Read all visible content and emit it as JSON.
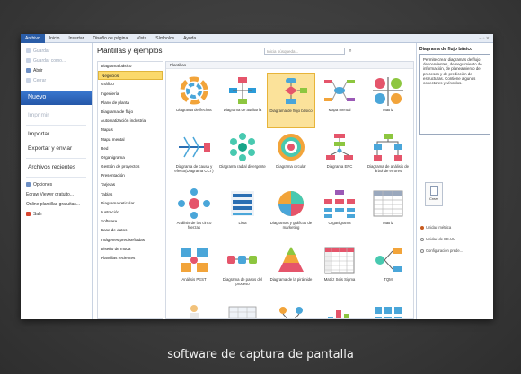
{
  "ribbon": {
    "tabs": [
      "Archivo",
      "Inicio",
      "Insertar",
      "Diseño de página",
      "Vista",
      "Símbolos",
      "Ayuda"
    ],
    "active_tab": "Archivo",
    "window_controls": "– ▫ ✕"
  },
  "backstage": {
    "top_items": [
      "Guardar",
      "Guardar como...",
      "Abrir",
      "Cerrar"
    ],
    "nuevo": "Nuevo",
    "imprimir": "Imprimir",
    "importar": "Importar",
    "exportar": "Exportar y enviar",
    "recientes": "Archivos recientes",
    "bottom_items": [
      "Opciones",
      "Edraw Viewer gratuito...",
      "Online plantillas gratuitas...",
      "Salir"
    ]
  },
  "main": {
    "title": "Plantillas y ejemplos",
    "search_placeholder": "Inicia búsqueda...",
    "grid_header": "Plantillas",
    "categories": [
      "Diagrama básico",
      "Negocios",
      "Gráfico",
      "Ingeniería",
      "Plano de planta",
      "Diagrama de flujo",
      "Automatización industrial",
      "Mapas",
      "Mapa mental",
      "Red",
      "Organigrama",
      "Gestión de proyectos",
      "Presentación",
      "Tarjetas",
      "Tablas",
      "Diagrama reticular",
      "Ilustración",
      "Software",
      "Base de datos",
      "Imágenes prediseñadas",
      "Diseño de moda",
      "Plantillas recientes"
    ],
    "selected_category": "Negocios",
    "templates": [
      {
        "label": "Diagrama de flechas",
        "icon": "circular-arrows-icon"
      },
      {
        "label": "Diagrama de auditoría",
        "icon": "audit-flow-icon"
      },
      {
        "label": "Diagrama de flujo básico",
        "icon": "basic-flowchart-icon"
      },
      {
        "label": "Mapa mental",
        "icon": "mind-map-icon"
      },
      {
        "label": "Matriz",
        "icon": "matrix-icon"
      },
      {
        "label": "Diagrama de causa y efecto(Diagrama CCT)",
        "icon": "fishbone-icon"
      },
      {
        "label": "Diagrama radial divergente",
        "icon": "radial-icon"
      },
      {
        "label": "Diagrama circular",
        "icon": "circular-icon"
      },
      {
        "label": "Diagrama EPC",
        "icon": "epc-icon"
      },
      {
        "label": "Diagrama de análisis de árbol de errores",
        "icon": "fault-tree-icon"
      },
      {
        "label": "Análisis de las cinco fuerzas",
        "icon": "five-forces-icon"
      },
      {
        "label": "Lista",
        "icon": "list-icon"
      },
      {
        "label": "Diagramas y gráficos de marketing",
        "icon": "marketing-icon"
      },
      {
        "label": "Organigrama",
        "icon": "org-chart-icon"
      },
      {
        "label": "Matriz",
        "icon": "matrix-table-icon"
      },
      {
        "label": "Análisis PEST",
        "icon": "pest-icon"
      },
      {
        "label": "Diagrama de pasos del proceso",
        "icon": "process-steps-icon"
      },
      {
        "label": "Diagrama de la pirámide",
        "icon": "pyramid-icon"
      },
      {
        "label": "Matriz Seis Sigma",
        "icon": "six-sigma-icon"
      },
      {
        "label": "TQM",
        "icon": "tqm-icon"
      },
      {
        "label": "",
        "icon": "person-icon"
      },
      {
        "label": "",
        "icon": "table-icon"
      },
      {
        "label": "",
        "icon": "flow-icon"
      },
      {
        "label": "",
        "icon": "chart-icon"
      },
      {
        "label": "",
        "icon": "grid-icon"
      }
    ],
    "selected_template": 2
  },
  "right": {
    "title": "Diagrama de flujo básico",
    "description": "Permite crear diagramas de flujo, descendentes, de seguimiento de información, de planeamiento de procesos y de predicción de estructuras. Contiene algunos conectores y vínculos.",
    "create_label": "Crear",
    "options": [
      "Unidad métrica",
      "Unidad de EE.UU",
      "Configuración prede..."
    ]
  },
  "caption": "software de captura de pantalla",
  "colors": {
    "accent": "#2a5da8",
    "selected": "#fbd96b"
  }
}
